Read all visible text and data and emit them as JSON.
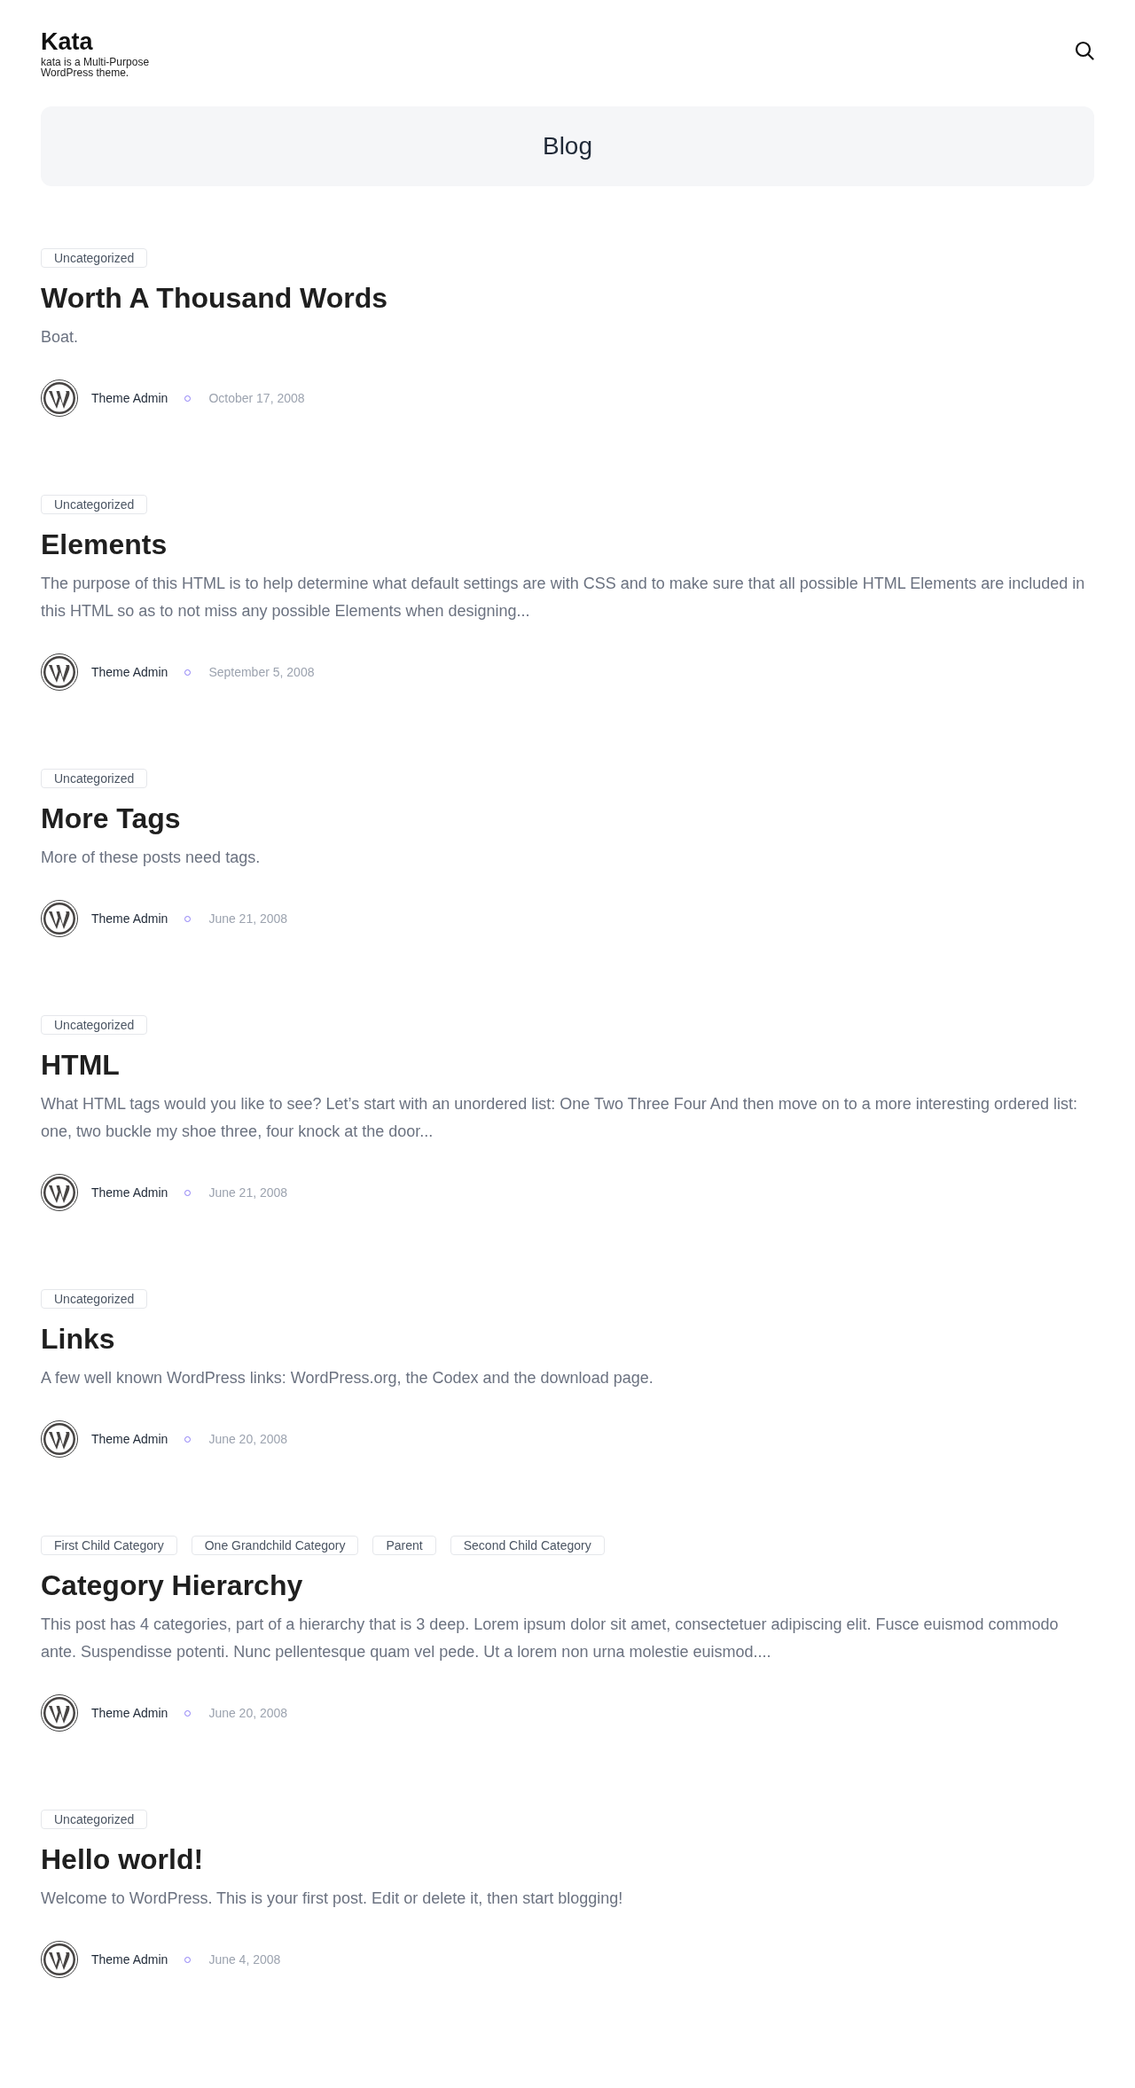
{
  "site": {
    "title": "Kata",
    "tagline": "kata is a Multi-Purpose WordPress theme."
  },
  "banner": {
    "title": "Blog"
  },
  "posts": [
    {
      "categories": [
        "Uncategorized"
      ],
      "title": "Worth A Thousand Words",
      "excerpt": "Boat.",
      "author": "Theme Admin",
      "date": "October 17, 2008"
    },
    {
      "categories": [
        "Uncategorized"
      ],
      "title": "Elements",
      "excerpt": "The purpose of this HTML is to help determine what default settings are with CSS and to make sure that all possible HTML Elements are included in this HTML so as to not miss any possible Elements when designing...",
      "author": "Theme Admin",
      "date": "September 5, 2008"
    },
    {
      "categories": [
        "Uncategorized"
      ],
      "title": "More Tags",
      "excerpt": "More of these posts need tags.",
      "author": "Theme Admin",
      "date": "June 21, 2008"
    },
    {
      "categories": [
        "Uncategorized"
      ],
      "title": "HTML",
      "excerpt": "What HTML tags would you like to see? Let’s start with an unordered list: One Two Three Four And then move on to a more interesting ordered list: one, two buckle my shoe three, four knock at the door...",
      "author": "Theme Admin",
      "date": "June 21, 2008"
    },
    {
      "categories": [
        "Uncategorized"
      ],
      "title": "Links",
      "excerpt": "A few well known WordPress links: WordPress.org, the Codex and the download page.",
      "author": "Theme Admin",
      "date": "June 20, 2008"
    },
    {
      "categories": [
        "First Child Category",
        "One Grandchild Category",
        "Parent",
        "Second Child Category"
      ],
      "title": "Category Hierarchy",
      "excerpt": "This post has 4 categories, part of a hierarchy that is 3 deep. Lorem ipsum dolor sit amet, consectetuer adipiscing elit. Fusce euismod commodo ante. Suspendisse potenti. Nunc pellentesque quam vel pede. Ut a lorem non urna molestie euismod....",
      "author": "Theme Admin",
      "date": "June 20, 2008"
    },
    {
      "categories": [
        "Uncategorized"
      ],
      "title": "Hello world!",
      "excerpt": "Welcome to WordPress. This is your first post. Edit or delete it, then start blogging!",
      "author": "Theme Admin",
      "date": "June 4, 2008"
    }
  ]
}
